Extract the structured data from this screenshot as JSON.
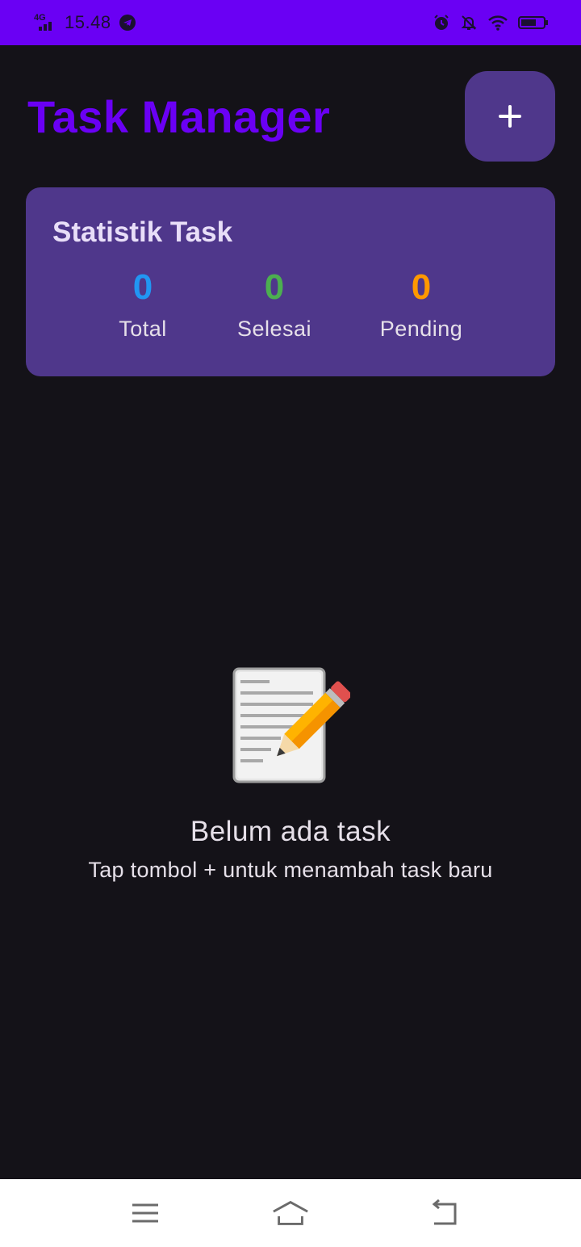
{
  "status_bar": {
    "network": "4G",
    "time": "15.48",
    "icons": [
      "telegram-icon",
      "alarm-icon",
      "bell-off-icon",
      "wifi-icon",
      "battery-icon"
    ]
  },
  "header": {
    "title": "Task Manager",
    "add_label": "+"
  },
  "stats": {
    "title": "Statistik Task",
    "items": [
      {
        "value": "0",
        "label": "Total",
        "color": "#2196f3"
      },
      {
        "value": "0",
        "label": "Selesai",
        "color": "#4caf50"
      },
      {
        "value": "0",
        "label": "Pending",
        "color": "#ff9800"
      }
    ]
  },
  "empty_state": {
    "icon": "memo-icon",
    "title": "Belum ada task",
    "subtitle": "Tap tombol + untuk menambah task baru"
  },
  "nav_bar": {
    "icons": [
      "menu-icon",
      "home-icon",
      "back-icon"
    ]
  },
  "colors": {
    "status_bar": "#6a00f4",
    "background": "#141218",
    "card": "#4f378b",
    "accent_title": "#6a00f4"
  }
}
